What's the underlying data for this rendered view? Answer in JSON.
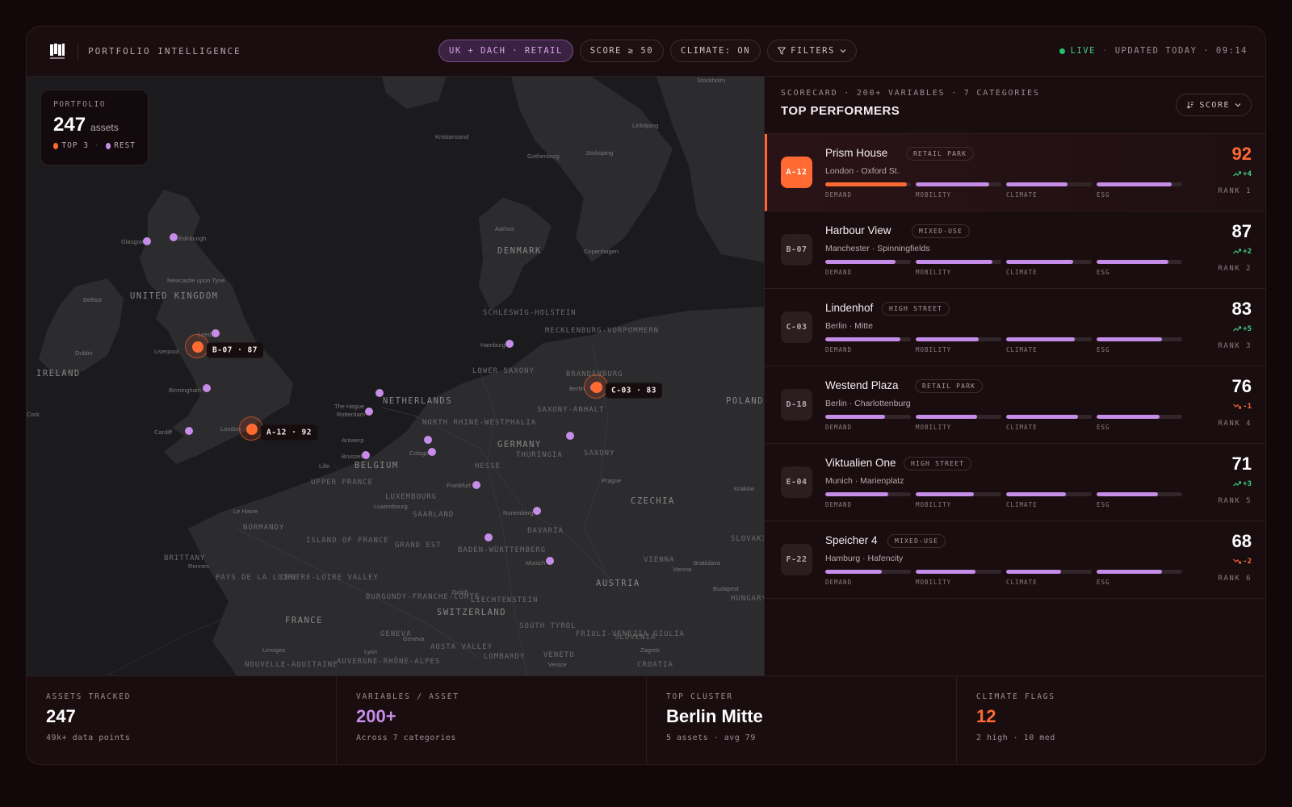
{
  "header": {
    "brand_label": "PORTFOLIO INTELLIGENCE",
    "chips": [
      {
        "label": "UK + DACH · RETAIL"
      },
      {
        "label": "SCORE ≥ 50"
      },
      {
        "label": "CLIMATE: ON"
      },
      {
        "label": "FILTERS"
      }
    ],
    "status_live": "LIVE",
    "status_updated": "UPDATED TODAY · 09:14"
  },
  "map": {
    "portfolio": {
      "caption": "PORTFOLIO",
      "count": "247",
      "unit": "assets",
      "legend_top": "TOP 3",
      "legend_rest": "REST"
    },
    "countries": [
      "UNITED KINGDOM",
      "IRELAND",
      "DENMARK",
      "NETHERLANDS",
      "BELGIUM",
      "GERMANY",
      "FRANCE",
      "POLAND",
      "CZECHIA",
      "AUSTRIA",
      "SWITZERLAND",
      "LUXEMBOURG"
    ],
    "regions": [
      "LOWER SAXONY",
      "SCHLESWIG-HOLSTEIN",
      "MECKLENBURG-VORPOMMERN",
      "BRANDENBURG",
      "SAXONY-ANHALT",
      "NORTH RHINE-WESTPHALIA",
      "HESSE",
      "THURINGIA",
      "SAXONY",
      "BAVARIA",
      "BADEN-WÜRTTEMBERG",
      "NORMANDY",
      "BRITTANY",
      "ISLAND OF FRANCE",
      "GRAND EST",
      "UPPER FRANCE",
      "SAARLAND",
      "PAYS DE LA LOIRE",
      "CENTRE-LOIRE VALLEY",
      "BURGUNDY-FRANCHE-COMTÉ",
      "LIECHTENSTEIN",
      "SLOVENIA",
      "CROATIA",
      "VIENNA",
      "HUNGARY",
      "SLOVAKIA",
      "SOUTH TYROL",
      "VENETO",
      "FRIULI-VENEZIA GIULIA",
      "GENEVA",
      "AOSTA VALLEY",
      "LOMBARDY",
      "NOUVELLE-AQUITAINE",
      "AUVERGNE-RHÔNE-ALPES"
    ],
    "cities": [
      "Glasgow",
      "Edinburgh",
      "Newcastle upon Tyne",
      "Belfast",
      "Dublin",
      "Liverpool",
      "Leeds",
      "Birmingham",
      "Cardiff",
      "London",
      "Cork",
      "Hamburg",
      "Berlin",
      "The Hague",
      "Rotterdam",
      "Antwerp",
      "Brussels",
      "Cologne",
      "Frankfurt",
      "Nuremberg",
      "Munich",
      "Zurich",
      "Lille",
      "Luxembourg",
      "Le Havre",
      "Rennes",
      "Copenhagen",
      "Aarhus",
      "Gothenburg",
      "Stockholm",
      "Linköping",
      "Jönköping",
      "Kristiansand",
      "Prague",
      "Vienna",
      "Bratislava",
      "Budapest",
      "Zagreb",
      "Kraków",
      "Lyon",
      "Limoges",
      "Venice",
      "Geneva"
    ],
    "hotspots": [
      {
        "label": "B-07 · 87"
      },
      {
        "label": "A-12 · 92"
      },
      {
        "label": "C-03 · 83"
      }
    ]
  },
  "scorecard": {
    "caption": "SCORECARD · 200+ VARIABLES · 7 CATEGORIES",
    "title": "TOP PERFORMERS",
    "sort_label": "SCORE",
    "bar_labels": [
      "DEMAND",
      "MOBILITY",
      "CLIMATE",
      "ESG"
    ],
    "rows": [
      {
        "id": "A-12",
        "name": "Prism House",
        "tag": "RETAIL PARK",
        "location": "London · Oxford St.",
        "score": "92",
        "delta": "+4",
        "trend": "up",
        "rank": "RANK 1",
        "bars": [
          0.95,
          0.86,
          0.72,
          0.88
        ]
      },
      {
        "id": "B-07",
        "name": "Harbour View",
        "tag": "MIXED-USE",
        "location": "Manchester · Spinningfields",
        "score": "87",
        "delta": "+2",
        "trend": "up",
        "rank": "RANK 2",
        "bars": [
          0.82,
          0.9,
          0.78,
          0.84
        ]
      },
      {
        "id": "C-03",
        "name": "Lindenhof",
        "tag": "HIGH STREET",
        "location": "Berlin · Mitte",
        "score": "83",
        "delta": "+5",
        "trend": "up",
        "rank": "RANK 3",
        "bars": [
          0.88,
          0.74,
          0.8,
          0.76
        ]
      },
      {
        "id": "D-18",
        "name": "Westend Plaza",
        "tag": "RETAIL PARK",
        "location": "Berlin · Charlottenburg",
        "score": "76",
        "delta": "-1",
        "trend": "down",
        "rank": "RANK 4",
        "bars": [
          0.7,
          0.72,
          0.84,
          0.74
        ]
      },
      {
        "id": "E-04",
        "name": "Viktualien One",
        "tag": "HIGH STREET",
        "location": "Munich · Marienplatz",
        "score": "71",
        "delta": "+3",
        "trend": "up",
        "rank": "RANK 5",
        "bars": [
          0.74,
          0.68,
          0.7,
          0.72
        ]
      },
      {
        "id": "F-22",
        "name": "Speicher 4",
        "tag": "MIXED-USE",
        "location": "Hamburg · Hafencity",
        "score": "68",
        "delta": "-2",
        "trend": "down",
        "rank": "RANK 6",
        "bars": [
          0.66,
          0.7,
          0.64,
          0.76
        ]
      }
    ]
  },
  "stats": [
    {
      "caption": "ASSETS TRACKED",
      "value": "247",
      "sub": "49k+ data points",
      "accent": "white"
    },
    {
      "caption": "VARIABLES / ASSET",
      "value": "200+",
      "sub": "Across 7 categories",
      "accent": "purple"
    },
    {
      "caption": "TOP CLUSTER",
      "value": "Berlin Mitte",
      "sub": "5 assets · avg 79",
      "accent": "white"
    },
    {
      "caption": "CLIMATE FLAGS",
      "value": "12",
      "sub": "2 high · 10 med",
      "accent": "orange"
    }
  ],
  "colors": {
    "accent": "#ff6a33",
    "purple": "#c58ce8",
    "live": "#24c26e"
  }
}
